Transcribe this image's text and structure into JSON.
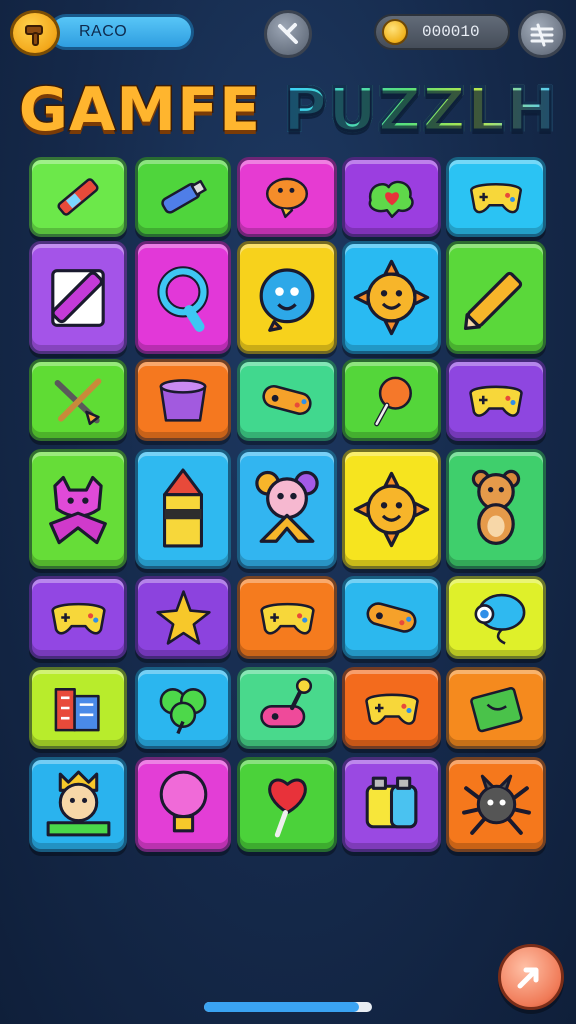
{
  "header": {
    "player_name": "RACO",
    "coins": "000010"
  },
  "title": {
    "word1": "GAMFE",
    "word2": "PUZZLH"
  },
  "grid": {
    "rows": 7,
    "cols": 5,
    "tiles": [
      {
        "color": "#6ce84a",
        "icon": "crayon-icon"
      },
      {
        "color": "#4fd53c",
        "icon": "tube-icon"
      },
      {
        "color": "#e63bd2",
        "icon": "cookie-creature-icon"
      },
      {
        "color": "#9b3ee0",
        "icon": "heart-cloud-icon"
      },
      {
        "color": "#2bc3f3",
        "icon": "gamepad-icon"
      },
      {
        "color": "#a454e8",
        "icon": "crayon-card-icon"
      },
      {
        "color": "#e238d8",
        "icon": "magnifier-icon"
      },
      {
        "color": "#f7d21c",
        "icon": "blob-creature-icon"
      },
      {
        "color": "#29baf2",
        "icon": "sun-face-icon"
      },
      {
        "color": "#5ad83a",
        "icon": "pencil-icon"
      },
      {
        "color": "#5fdc34",
        "icon": "crossed-swords-icon"
      },
      {
        "color": "#f5781f",
        "icon": "bucket-icon"
      },
      {
        "color": "#41d88e",
        "icon": "controller-flat-icon"
      },
      {
        "color": "#54d63a",
        "icon": "lollipop-icon"
      },
      {
        "color": "#8e46e0",
        "icon": "gamepad-icon"
      },
      {
        "color": "#66dd38",
        "icon": "cat-character-icon"
      },
      {
        "color": "#2fb9f0",
        "icon": "rocket-icon"
      },
      {
        "color": "#32b5f0",
        "icon": "bear-character-icon"
      },
      {
        "color": "#f6e41f",
        "icon": "sun-face-icon"
      },
      {
        "color": "#3fcf6c",
        "icon": "teddy-bear-icon"
      },
      {
        "color": "#9247e3",
        "icon": "gamepad-icon"
      },
      {
        "color": "#8c43de",
        "icon": "star-icon"
      },
      {
        "color": "#f57b1e",
        "icon": "gamepad-icon"
      },
      {
        "color": "#2cb8ee",
        "icon": "controller-flat-icon"
      },
      {
        "color": "#dff02a",
        "icon": "balloon-icon"
      },
      {
        "color": "#b8ec2c",
        "icon": "buildings-icon"
      },
      {
        "color": "#2bb6ef",
        "icon": "clover-icon"
      },
      {
        "color": "#49d98c",
        "icon": "joystick-icon"
      },
      {
        "color": "#f36b1d",
        "icon": "gamepad-icon"
      },
      {
        "color": "#f58a1e",
        "icon": "green-card-icon"
      },
      {
        "color": "#2ab3ee",
        "icon": "king-cat-icon"
      },
      {
        "color": "#e33ed6",
        "icon": "lightbulb-icon"
      },
      {
        "color": "#4bd23a",
        "icon": "heart-lollipop-icon"
      },
      {
        "color": "#9a49e2",
        "icon": "battery-jar-icon"
      },
      {
        "color": "#f5781c",
        "icon": "spider-icon"
      }
    ]
  },
  "scroll": {
    "progress": 0.92
  }
}
